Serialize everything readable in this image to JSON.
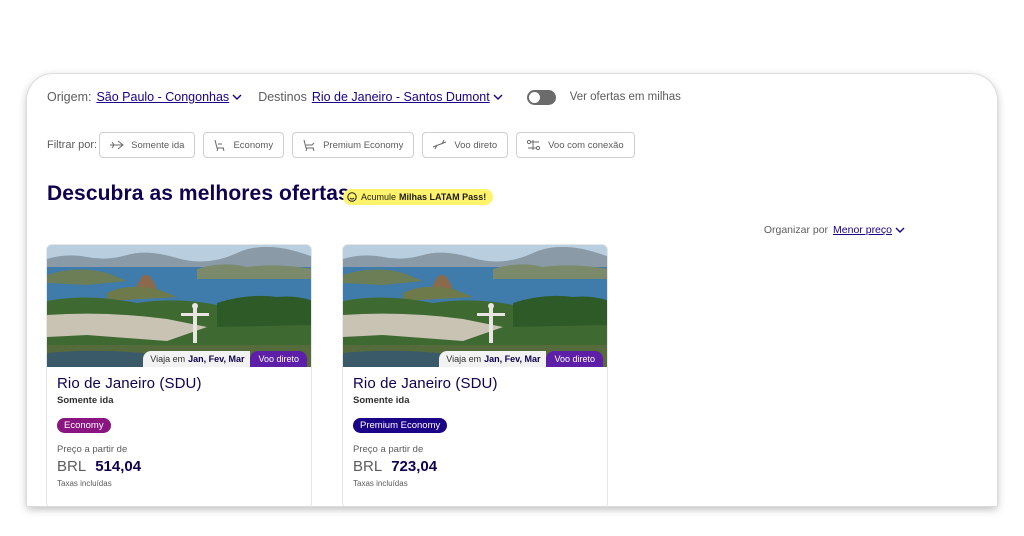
{
  "search": {
    "origin_label": "Origem:",
    "origin_value": "São Paulo - Congonhas",
    "destination_label": "Destinos",
    "destination_value": "Rio de Janeiro - Santos Dumont",
    "miles_toggle_label": "Ver ofertas em milhas",
    "miles_toggle_on": false
  },
  "filters": {
    "label": "Filtrar por:",
    "items": [
      {
        "label": "Somente ida",
        "icon": "plane-oneway-icon"
      },
      {
        "label": "Economy",
        "icon": "seat-economy-icon"
      },
      {
        "label": "Premium Economy",
        "icon": "seat-premium-icon"
      },
      {
        "label": "Voo direto",
        "icon": "plane-direct-icon"
      },
      {
        "label": "Voo com conexão",
        "icon": "connection-icon"
      }
    ]
  },
  "heading": {
    "title": "Descubra as melhores ofertas",
    "pill_prefix": "Acumule",
    "pill_bold": "Milhas LATAM Pass!"
  },
  "sort": {
    "label": "Organizar por",
    "value": "Menor preço"
  },
  "cards": [
    {
      "travel_prefix": "Viaja em",
      "travel_months": "Jan, Fev, Mar",
      "direct_badge": "Voo direto",
      "city": "Rio de Janeiro (SDU)",
      "trip_type": "Somente ida",
      "cabin": "Economy",
      "from_label": "Preço a partir de",
      "currency": "BRL",
      "price": "514,04",
      "tax_note": "Taxas incluídas"
    },
    {
      "travel_prefix": "Viaja em",
      "travel_months": "Jan, Fev, Mar",
      "direct_badge": "Voo direto",
      "city": "Rio de Janeiro (SDU)",
      "trip_type": "Somente ida",
      "cabin": "Premium Economy",
      "from_label": "Preço a partir de",
      "currency": "BRL",
      "price": "723,04",
      "tax_note": "Taxas incluídas"
    }
  ],
  "colors": {
    "brand_indigo": "#1b0088",
    "economy_magenta": "#8a1480",
    "direct_purple": "#5e1fa8",
    "pill_yellow": "#fff36b"
  }
}
